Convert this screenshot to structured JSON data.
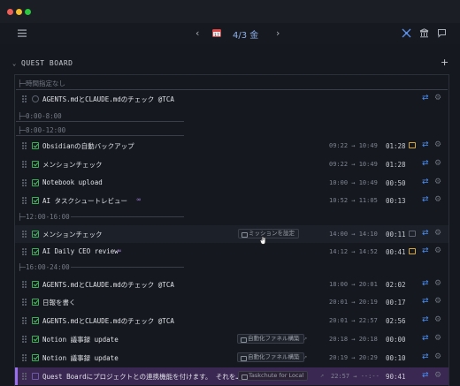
{
  "toolbar": {
    "menu_icon": "hamburger-menu-icon",
    "date": "4/3 金",
    "prev": "‹",
    "next": "›"
  },
  "quest_board": {
    "title": "QUEST BOARD",
    "add": "+"
  },
  "sections": [
    {
      "label": "├─時間指定なし"
    },
    {
      "label": "├─0:00-8:00"
    },
    {
      "label": "├─8:00-12:00"
    },
    {
      "label": "├─12:00-16:00"
    },
    {
      "label": "├─16:00-24:00"
    }
  ],
  "tasks": [
    {
      "name": "AGENTS.mdとCLAUDE.mdのチェック  @TCA",
      "status": "none",
      "times": "",
      "duration": "",
      "tag": "",
      "comment": "",
      "link": false
    },
    {
      "name": "Obsidianの自動バックアップ",
      "status": "done",
      "times": "09:22 → 10:49",
      "duration": "01:28",
      "tag": "",
      "comment": "yellow",
      "link": false
    },
    {
      "name": "メンションチェック",
      "status": "done",
      "times": "09:22 → 10:49",
      "duration": "01:28",
      "tag": "",
      "comment": "",
      "link": false
    },
    {
      "name": "Notebook upload",
      "status": "done",
      "times": "10:00 → 10:49",
      "duration": "00:50",
      "tag": "",
      "comment": "",
      "link": false
    },
    {
      "name": "AI タスクシュートレビュー",
      "status": "done",
      "times": "10:52 → 11:05",
      "duration": "00:13",
      "tag": "",
      "comment": "",
      "link": true
    },
    {
      "name": "メンションチェック",
      "status": "done",
      "times": "14:00 → 14:10",
      "duration": "00:11",
      "tag": "ミッションを設定",
      "comment": "dim",
      "link": false
    },
    {
      "name": "AI Daily CEO review",
      "status": "done",
      "times": "14:12 → 14:52",
      "duration": "00:41",
      "tag": "",
      "comment": "yellow",
      "link": true
    },
    {
      "name": "AGENTS.mdとCLAUDE.mdのチェック  @TCA",
      "status": "done",
      "times": "18:00 → 20:01",
      "duration": "02:02",
      "tag": "",
      "comment": "",
      "link": false
    },
    {
      "name": "日報を書く",
      "status": "done",
      "times": "20:01 → 20:19",
      "duration": "00:17",
      "tag": "",
      "comment": "",
      "link": false
    },
    {
      "name": "AGENTS.mdとCLAUDE.mdのチェック  @TCA",
      "status": "done",
      "times": "20:01 → 22:57",
      "duration": "02:56",
      "tag": "",
      "comment": "",
      "link": false
    },
    {
      "name": "Notion 議事録 update",
      "status": "done",
      "times": "20:18 → 20:18",
      "duration": "00:00",
      "tag": "自動化ファネル構築",
      "comment": "",
      "link": false
    },
    {
      "name": "Notion 議事録 update",
      "status": "done",
      "times": "20:19 → 20:29",
      "duration": "00:10",
      "tag": "自動化ファネル構築",
      "comment": "",
      "link": false
    },
    {
      "name": "Quest Boardにプロジェクトとの連携機能を付けます。 それを…",
      "status": "running",
      "times": "22:57 → --:--",
      "duration": "90:41",
      "tag": "Taskchute for Local",
      "comment": "",
      "link": false
    }
  ],
  "colors": {
    "background": "#15181f",
    "accent_blue": "#4a8df0",
    "check_green": "#52c46a",
    "active_row": "#3a2752"
  }
}
